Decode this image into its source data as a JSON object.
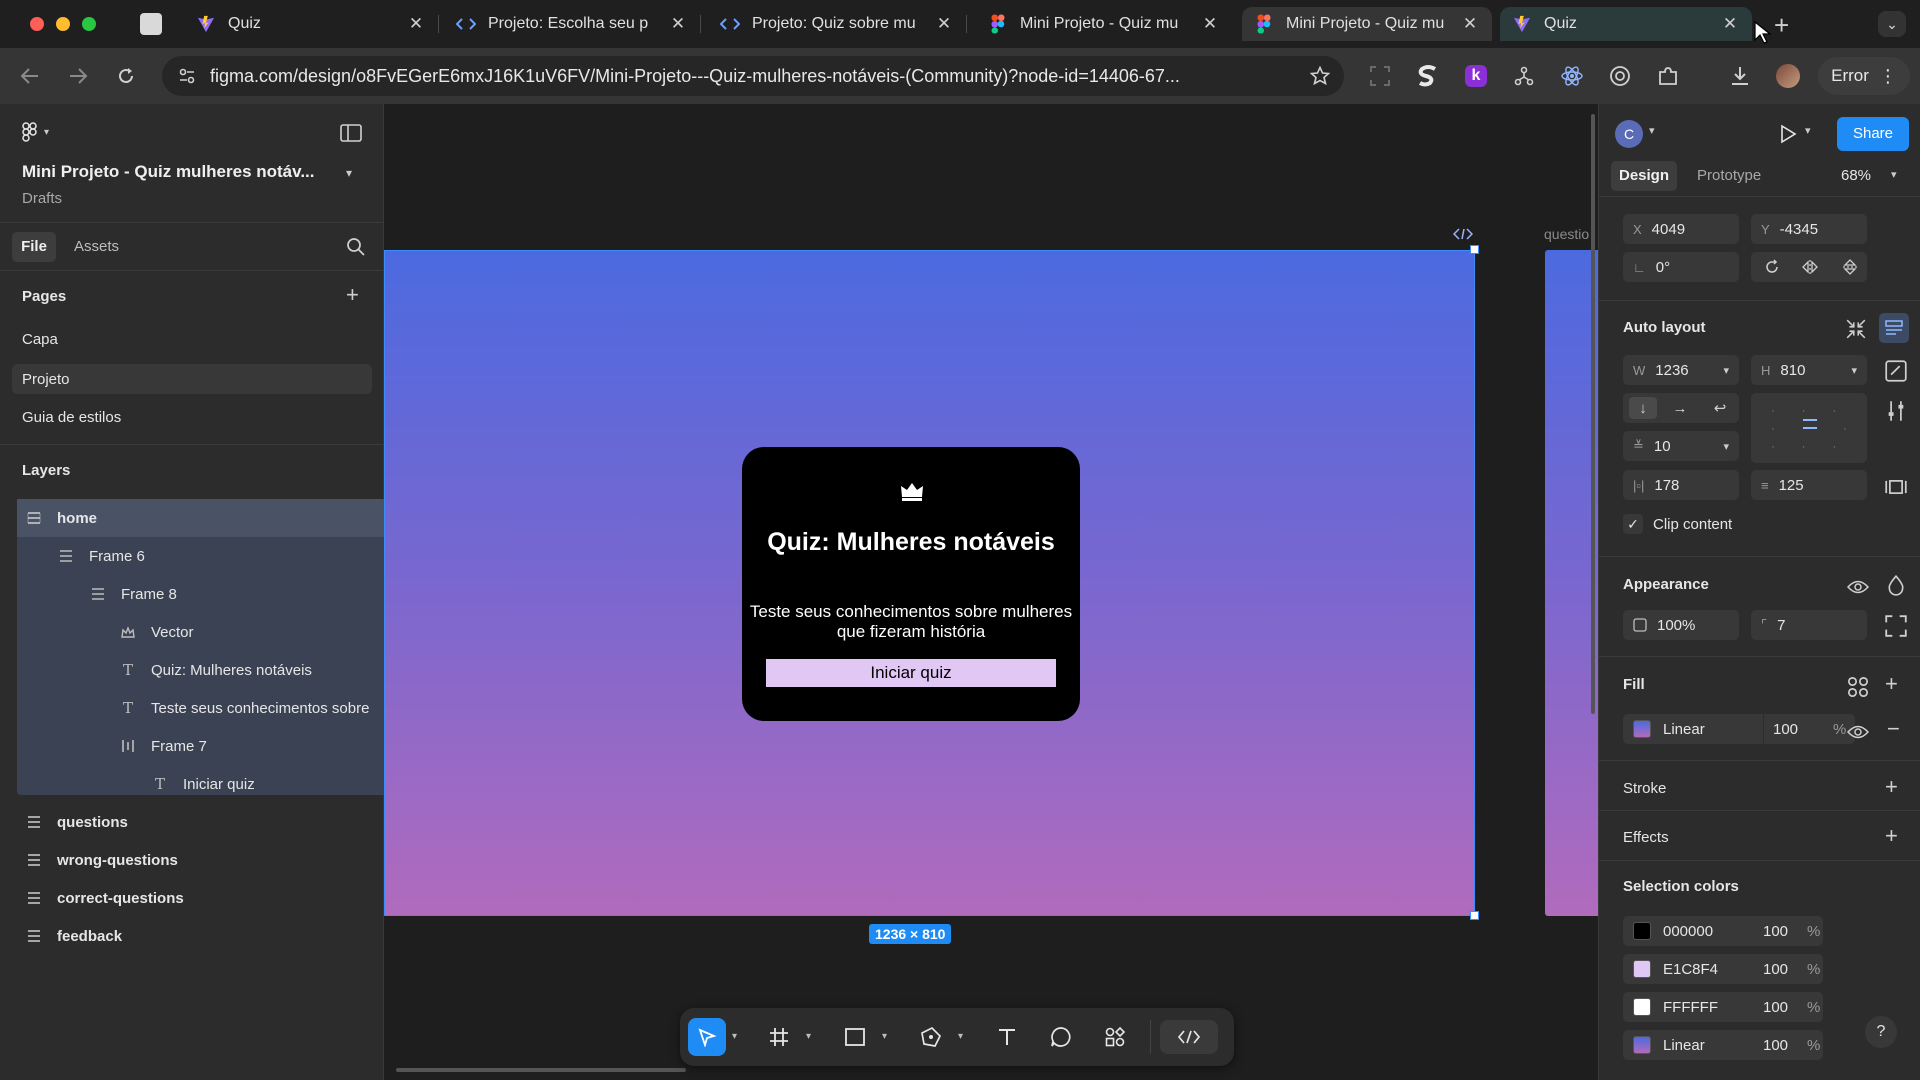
{
  "browser": {
    "tabs": [
      {
        "label": "Quiz",
        "icon": "vite-icon",
        "active": false
      },
      {
        "label": "Projeto: Escolha seu p",
        "icon": "code-icon",
        "active": false
      },
      {
        "label": "Projeto: Quiz sobre mu",
        "icon": "code-icon",
        "active": false
      },
      {
        "label": "Mini Projeto - Quiz mu",
        "icon": "figma-icon",
        "active": false
      },
      {
        "label": "Mini Projeto - Quiz mu",
        "icon": "figma-icon",
        "active": true
      },
      {
        "label": "Quiz",
        "icon": "vite-icon",
        "active": false
      }
    ],
    "url": "figma.com/design/o8FvEGerE6mxJ16K1uV6FV/Mini-Projeto---Quiz-mulheres-notáveis-(Community)?node-id=14406-67...",
    "error_label": "Error"
  },
  "figma": {
    "file_title": "Mini Projeto - Quiz mulheres notáv...",
    "file_location": "Drafts",
    "left_tabs": [
      "File",
      "Assets"
    ],
    "pages_heading": "Pages",
    "pages": [
      "Capa",
      "Projeto",
      "Guia de estilos"
    ],
    "layers_heading": "Layers",
    "layers": [
      {
        "name": "home",
        "icon": "frame-stack-icon",
        "indent": 0,
        "bold": true
      },
      {
        "name": "Frame 6",
        "icon": "frame-stack-icon",
        "indent": 1,
        "bold": false
      },
      {
        "name": "Frame 8",
        "icon": "frame-stack-icon",
        "indent": 2,
        "bold": false
      },
      {
        "name": "Vector",
        "icon": "vector-icon",
        "indent": 3,
        "bold": false
      },
      {
        "name": "Quiz: Mulheres notáveis",
        "icon": "text-icon",
        "indent": 3,
        "bold": false
      },
      {
        "name": "Teste seus conhecimentos sobre",
        "icon": "text-icon",
        "indent": 3,
        "bold": false
      },
      {
        "name": "Frame 7",
        "icon": "frame-columns-icon",
        "indent": 3,
        "bold": false
      },
      {
        "name": "Iniciar quiz",
        "icon": "text-icon",
        "indent": 4,
        "bold": false
      }
    ],
    "other_layers": [
      "questions",
      "wrong-questions",
      "correct-questions",
      "feedback"
    ]
  },
  "canvas": {
    "card_title": "Quiz: Mulheres notáveis",
    "card_subtitle": "Teste seus conhecimentos sobre mulheres que fizeram história",
    "card_button": "Iniciar quiz",
    "size_badge": "1236 × 810",
    "next_frame_label": "questio"
  },
  "design_panel": {
    "avatar_letter": "C",
    "share_label": "Share",
    "tabs": [
      "Design",
      "Prototype"
    ],
    "zoom": "68%",
    "x_label": "X",
    "x_value": "4049",
    "y_label": "Y",
    "y_value": "-4345",
    "rotation": "0°",
    "auto_layout_heading": "Auto layout",
    "w_label": "W",
    "w_value": "1236",
    "h_label": "H",
    "h_value": "810",
    "gap": "10",
    "padding_h": "178",
    "padding_v": "125",
    "clip_content": "Clip content",
    "appearance_heading": "Appearance",
    "opacity": "100%",
    "radius": "7",
    "fill_heading": "Fill",
    "fill_type": "Linear",
    "fill_opacity": "100",
    "percent": "%",
    "stroke_heading": "Stroke",
    "effects_heading": "Effects",
    "selection_colors_heading": "Selection colors",
    "selection_colors": [
      {
        "label": "000000",
        "opacity": "100",
        "color": "#000000"
      },
      {
        "label": "E1C8F4",
        "opacity": "100",
        "color": "#E1C8F4"
      },
      {
        "label": "FFFFFF",
        "opacity": "100",
        "color": "#FFFFFF"
      },
      {
        "label": "Linear",
        "opacity": "100",
        "color": "#6f6ad8"
      }
    ]
  },
  "colors": {
    "accent": "#1f8cf5",
    "gradient_top": "#4c6ae0",
    "gradient_bottom": "#b16bbd",
    "button_fill": "#E1C8F4"
  }
}
